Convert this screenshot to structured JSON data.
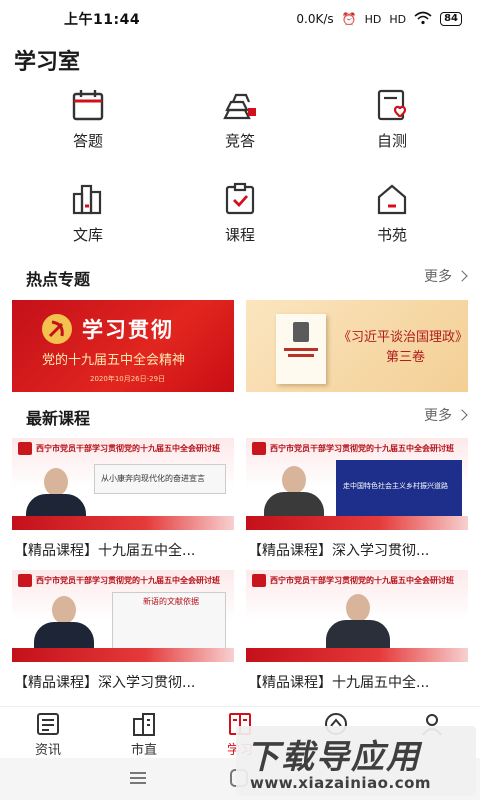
{
  "status": {
    "time": "上午11:44",
    "speed": "0.0K/s",
    "signal1": "HD",
    "signal2": "HD",
    "battery": "84"
  },
  "page": {
    "title": "学习室"
  },
  "grid": [
    {
      "label": "答题",
      "icon": "calendar-icon"
    },
    {
      "label": "竞答",
      "icon": "gold-bars-icon"
    },
    {
      "label": "自测",
      "icon": "heart-note-icon"
    },
    {
      "label": "文库",
      "icon": "books-icon"
    },
    {
      "label": "课程",
      "icon": "clipboard-check-icon"
    },
    {
      "label": "书苑",
      "icon": "house-icon"
    }
  ],
  "hot_topics": {
    "title": "热点专题",
    "more": "更多",
    "banners": [
      {
        "title": "学习贯彻",
        "subtitle": "党的十九届五中全会精神",
        "date": "2020年10月26日-29日"
      },
      {
        "title": "《习近平谈治国理政》",
        "subtitle": "第三卷"
      }
    ]
  },
  "latest": {
    "title": "最新课程",
    "more": "更多",
    "courses": [
      {
        "title": "【精品课程】十九届五中全...",
        "header": "西宁市党员干部学习贯彻党的十九届五中全会研讨班",
        "screen_text": "从小康奔向现代化的奋进宣言"
      },
      {
        "title": "【精品课程】深入学习贯彻...",
        "header": "西宁市党员干部学习贯彻党的十九届五中全会研讨班",
        "screen_text": "走中国特色社会主义乡村振兴道路"
      },
      {
        "title": "【精品课程】深入学习贯彻...",
        "header": "西宁市党员干部学习贯彻党的十九届五中全会研讨班",
        "screen_text": "新语的文献依据"
      },
      {
        "title": "【精品课程】十九届五中全...",
        "header": "西宁市党员干部学习贯彻党的十九届五中全会研讨班",
        "screen_text": ""
      }
    ]
  },
  "tabs": [
    {
      "label": "资讯",
      "icon": "news-icon"
    },
    {
      "label": "市直",
      "icon": "building-icon"
    },
    {
      "label": "学习",
      "icon": "book-icon",
      "active": true
    },
    {
      "label": "",
      "icon": "badge-icon"
    },
    {
      "label": "",
      "icon": "user-icon"
    }
  ],
  "watermark": {
    "main": "下载导应用",
    "url": "www.xiazainiao.com"
  },
  "colors": {
    "accent": "#d0101a",
    "icon_dark": "#333333"
  }
}
